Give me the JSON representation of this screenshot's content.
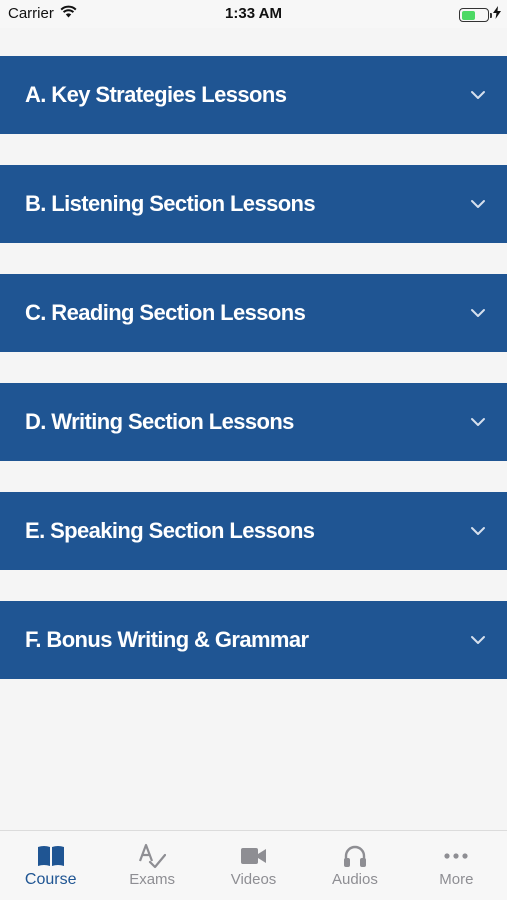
{
  "status_bar": {
    "carrier": "Carrier",
    "time": "1:33 AM"
  },
  "sections": [
    {
      "label": "A. Key Strategies Lessons"
    },
    {
      "label": "B. Listening Section Lessons"
    },
    {
      "label": "C. Reading Section Lessons"
    },
    {
      "label": "D. Writing Section Lessons"
    },
    {
      "label": "E. Speaking Section Lessons"
    },
    {
      "label": "F. Bonus Writing & Grammar"
    }
  ],
  "tab_bar": {
    "tabs": [
      {
        "label": "Course",
        "icon": "book-icon",
        "active": true
      },
      {
        "label": "Exams",
        "icon": "spellcheck-icon"
      },
      {
        "label": "Videos",
        "icon": "video-camera-icon"
      },
      {
        "label": "Audios",
        "icon": "headphones-icon"
      },
      {
        "label": "More",
        "icon": "more-icon"
      }
    ]
  },
  "colors": {
    "section_bg": "#1f5593",
    "active_tab": "#1f5593",
    "inactive_tab": "#8e8e93",
    "battery": "#4cd964"
  }
}
